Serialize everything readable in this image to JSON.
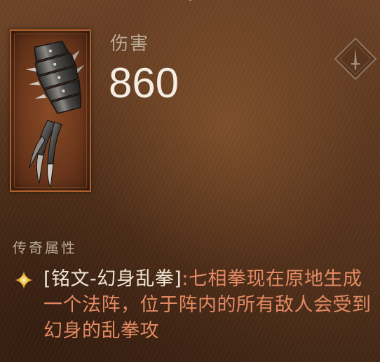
{
  "tooltip": {
    "damage_label": "伤害",
    "damage_value": "860",
    "weapon_type_icon": "dagger-diamond-icon",
    "item_icon": "gauntlet-claw-icon"
  },
  "legendary": {
    "section_title": "传奇属性",
    "bullet_icon": "four-point-star-icon",
    "affix_name": "[铭文-幻身乱拳]",
    "affix_description": ":七相拳现在原地生成一个法阵，位于阵内的所有敌人会受到幻身的乱拳攻"
  },
  "colors": {
    "affix_description": "#e38a62",
    "affix_name": "#f0e6d6",
    "stat_value": "#f3ede3",
    "label": "#b9aa98",
    "frame_border": "#b0612f"
  }
}
